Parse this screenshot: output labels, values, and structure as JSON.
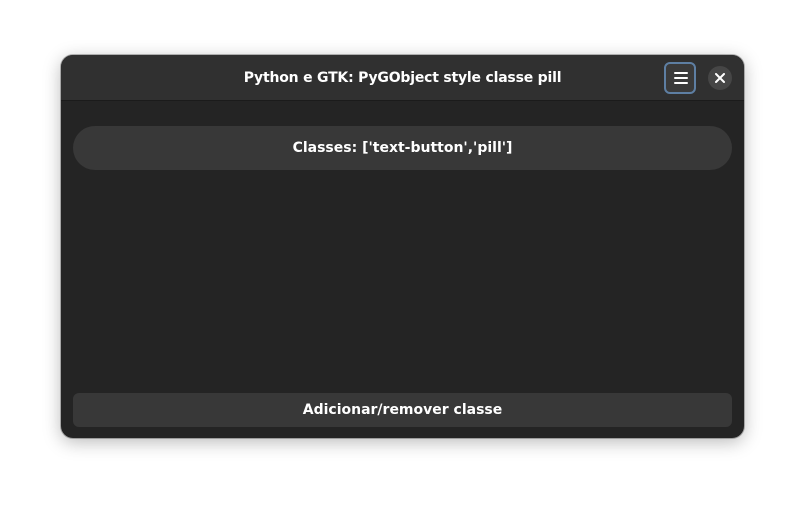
{
  "window": {
    "title": "Python e GTK: PyGObject style classe pill"
  },
  "headerbar": {
    "menu_icon": "hamburger-menu-icon",
    "close_icon": "close-icon"
  },
  "main": {
    "pill_button_label": "Classes: ['text-button','pill']",
    "toggle_button_label": "Adicionar/remover classe"
  },
  "colors": {
    "window_bg": "#242424",
    "headerbar_bg": "#303030",
    "button_bg": "#383838",
    "focus_ring": "#5e7fa3",
    "text": "#ffffff"
  }
}
